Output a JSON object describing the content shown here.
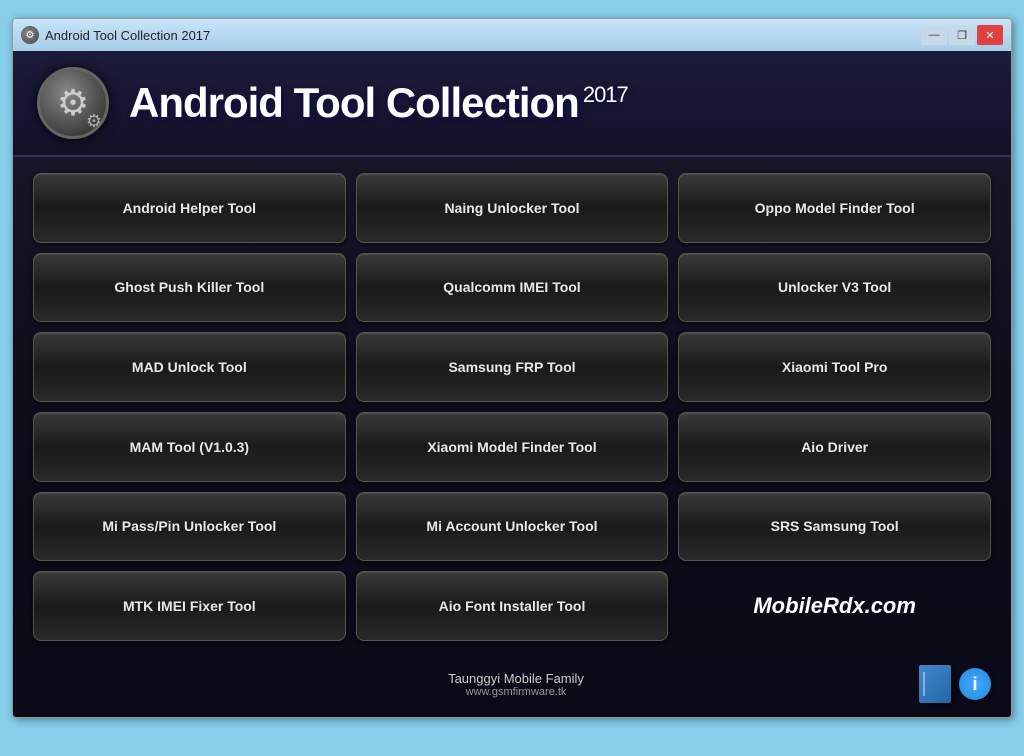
{
  "titlebar": {
    "title": "Android Tool Collection 2017",
    "icon": "⚙",
    "minimize": "—",
    "restore": "❐",
    "close": "✕"
  },
  "header": {
    "app_title": "Android Tool Collection",
    "year": "2017"
  },
  "buttons": [
    {
      "id": "android-helper",
      "label": "Android Helper Tool"
    },
    {
      "id": "naing-unlocker",
      "label": "Naing Unlocker Tool"
    },
    {
      "id": "oppo-model-finder",
      "label": "Oppo Model Finder Tool"
    },
    {
      "id": "ghost-push-killer",
      "label": "Ghost Push Killer Tool"
    },
    {
      "id": "qualcomm-imei",
      "label": "Qualcomm IMEI Tool"
    },
    {
      "id": "unlocker-v3",
      "label": "Unlocker V3 Tool"
    },
    {
      "id": "mad-unlock",
      "label": "MAD Unlock Tool"
    },
    {
      "id": "samsung-frp",
      "label": "Samsung FRP Tool"
    },
    {
      "id": "xiaomi-tool-pro",
      "label": "Xiaomi Tool Pro"
    },
    {
      "id": "mam-tool",
      "label": "MAM Tool (V1.0.3)"
    },
    {
      "id": "xiaomi-model-finder",
      "label": "Xiaomi Model Finder Tool"
    },
    {
      "id": "aio-driver",
      "label": "Aio Driver"
    },
    {
      "id": "mi-pass-pin-unlocker",
      "label": "Mi Pass/Pin Unlocker Tool"
    },
    {
      "id": "mi-account-unlocker",
      "label": "Mi Account Unlocker Tool"
    },
    {
      "id": "srs-samsung",
      "label": "SRS Samsung Tool"
    },
    {
      "id": "mtk-imei-fixer",
      "label": "MTK IMEI Fixer Tool"
    },
    {
      "id": "aio-font-installer",
      "label": "Aio Font Installer Tool"
    },
    {
      "id": "brand",
      "label": "MobileRdx.com",
      "type": "brand"
    }
  ],
  "footer": {
    "family": "Taunggyi Mobile Family",
    "url": "www.gsmfirmware.tk"
  }
}
